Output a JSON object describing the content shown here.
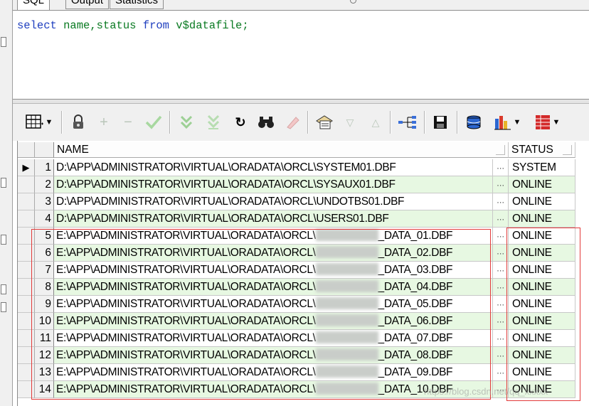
{
  "tabs": [
    {
      "label": "SQL",
      "active": true
    },
    {
      "label": "Output",
      "active": false
    },
    {
      "label": "Statistics",
      "active": false
    }
  ],
  "editor": {
    "sql": {
      "kw1": "select",
      "cols": "name,status",
      "kw2": "from",
      "table": "v$datafile",
      "end": ";"
    }
  },
  "toolbar": {
    "icons": [
      "grid-layout-icon",
      "lock-icon",
      "add-record-icon",
      "remove-record-icon",
      "post-edit-icon",
      "move-down-icon",
      "move-down-all-icon",
      "refresh-icon",
      "find-icon",
      "clear-icon",
      "record-view-icon",
      "sort-desc-icon",
      "sort-asc-icon",
      "tree-link-icon",
      "save-icon",
      "export-icon",
      "chart-icon",
      "table-icon"
    ]
  },
  "grid": {
    "columns": [
      "NAME",
      "STATUS"
    ],
    "rows": [
      {
        "num": "1",
        "prefix": "D:\\APP\\ADMINISTRATOR\\VIRTUAL\\ORADATA\\ORCL\\SYSTEM01.DBF",
        "suffix": "",
        "status": "SYSTEM"
      },
      {
        "num": "2",
        "prefix": "D:\\APP\\ADMINISTRATOR\\VIRTUAL\\ORADATA\\ORCL\\SYSAUX01.DBF",
        "suffix": "",
        "status": "ONLINE"
      },
      {
        "num": "3",
        "prefix": "D:\\APP\\ADMINISTRATOR\\VIRTUAL\\ORADATA\\ORCL\\UNDOTBS01.DBF",
        "suffix": "",
        "status": "ONLINE"
      },
      {
        "num": "4",
        "prefix": "D:\\APP\\ADMINISTRATOR\\VIRTUAL\\ORADATA\\ORCL\\USERS01.DBF",
        "suffix": "",
        "status": "ONLINE"
      },
      {
        "num": "5",
        "prefix": "E:\\APP\\ADMINISTRATOR\\VIRTUAL\\ORADATA\\ORCL\\",
        "suffix": "_DATA_01.DBF",
        "status": "ONLINE"
      },
      {
        "num": "6",
        "prefix": "E:\\APP\\ADMINISTRATOR\\VIRTUAL\\ORADATA\\ORCL\\",
        "suffix": "_DATA_02.DBF",
        "status": "ONLINE"
      },
      {
        "num": "7",
        "prefix": "E:\\APP\\ADMINISTRATOR\\VIRTUAL\\ORADATA\\ORCL\\",
        "suffix": "_DATA_03.DBF",
        "status": "ONLINE"
      },
      {
        "num": "8",
        "prefix": "E:\\APP\\ADMINISTRATOR\\VIRTUAL\\ORADATA\\ORCL\\",
        "suffix": "_DATA_04.DBF",
        "status": "ONLINE"
      },
      {
        "num": "9",
        "prefix": "E:\\APP\\ADMINISTRATOR\\VIRTUAL\\ORADATA\\ORCL\\",
        "suffix": "_DATA_05.DBF",
        "status": "ONLINE"
      },
      {
        "num": "10",
        "prefix": "E:\\APP\\ADMINISTRATOR\\VIRTUAL\\ORADATA\\ORCL\\",
        "suffix": "_DATA_06.DBF",
        "status": "ONLINE"
      },
      {
        "num": "11",
        "prefix": "E:\\APP\\ADMINISTRATOR\\VIRTUAL\\ORADATA\\ORCL\\",
        "suffix": "_DATA_07.DBF",
        "status": "ONLINE"
      },
      {
        "num": "12",
        "prefix": "E:\\APP\\ADMINISTRATOR\\VIRTUAL\\ORADATA\\ORCL\\",
        "suffix": "_DATA_08.DBF",
        "status": "ONLINE"
      },
      {
        "num": "13",
        "prefix": "E:\\APP\\ADMINISTRATOR\\VIRTUAL\\ORADATA\\ORCL\\",
        "suffix": "_DATA_09.DBF",
        "status": "ONLINE"
      },
      {
        "num": "14",
        "prefix": "E:\\APP\\ADMINISTRATOR\\VIRTUAL\\ORADATA\\ORCL\\",
        "suffix": "_DATA_10.DBF",
        "status": "ONLINE"
      }
    ],
    "ellipsis": "···",
    "current_row_marker": "▶"
  },
  "watermark": "https://blog.csdn.net/qq_xxxxx"
}
